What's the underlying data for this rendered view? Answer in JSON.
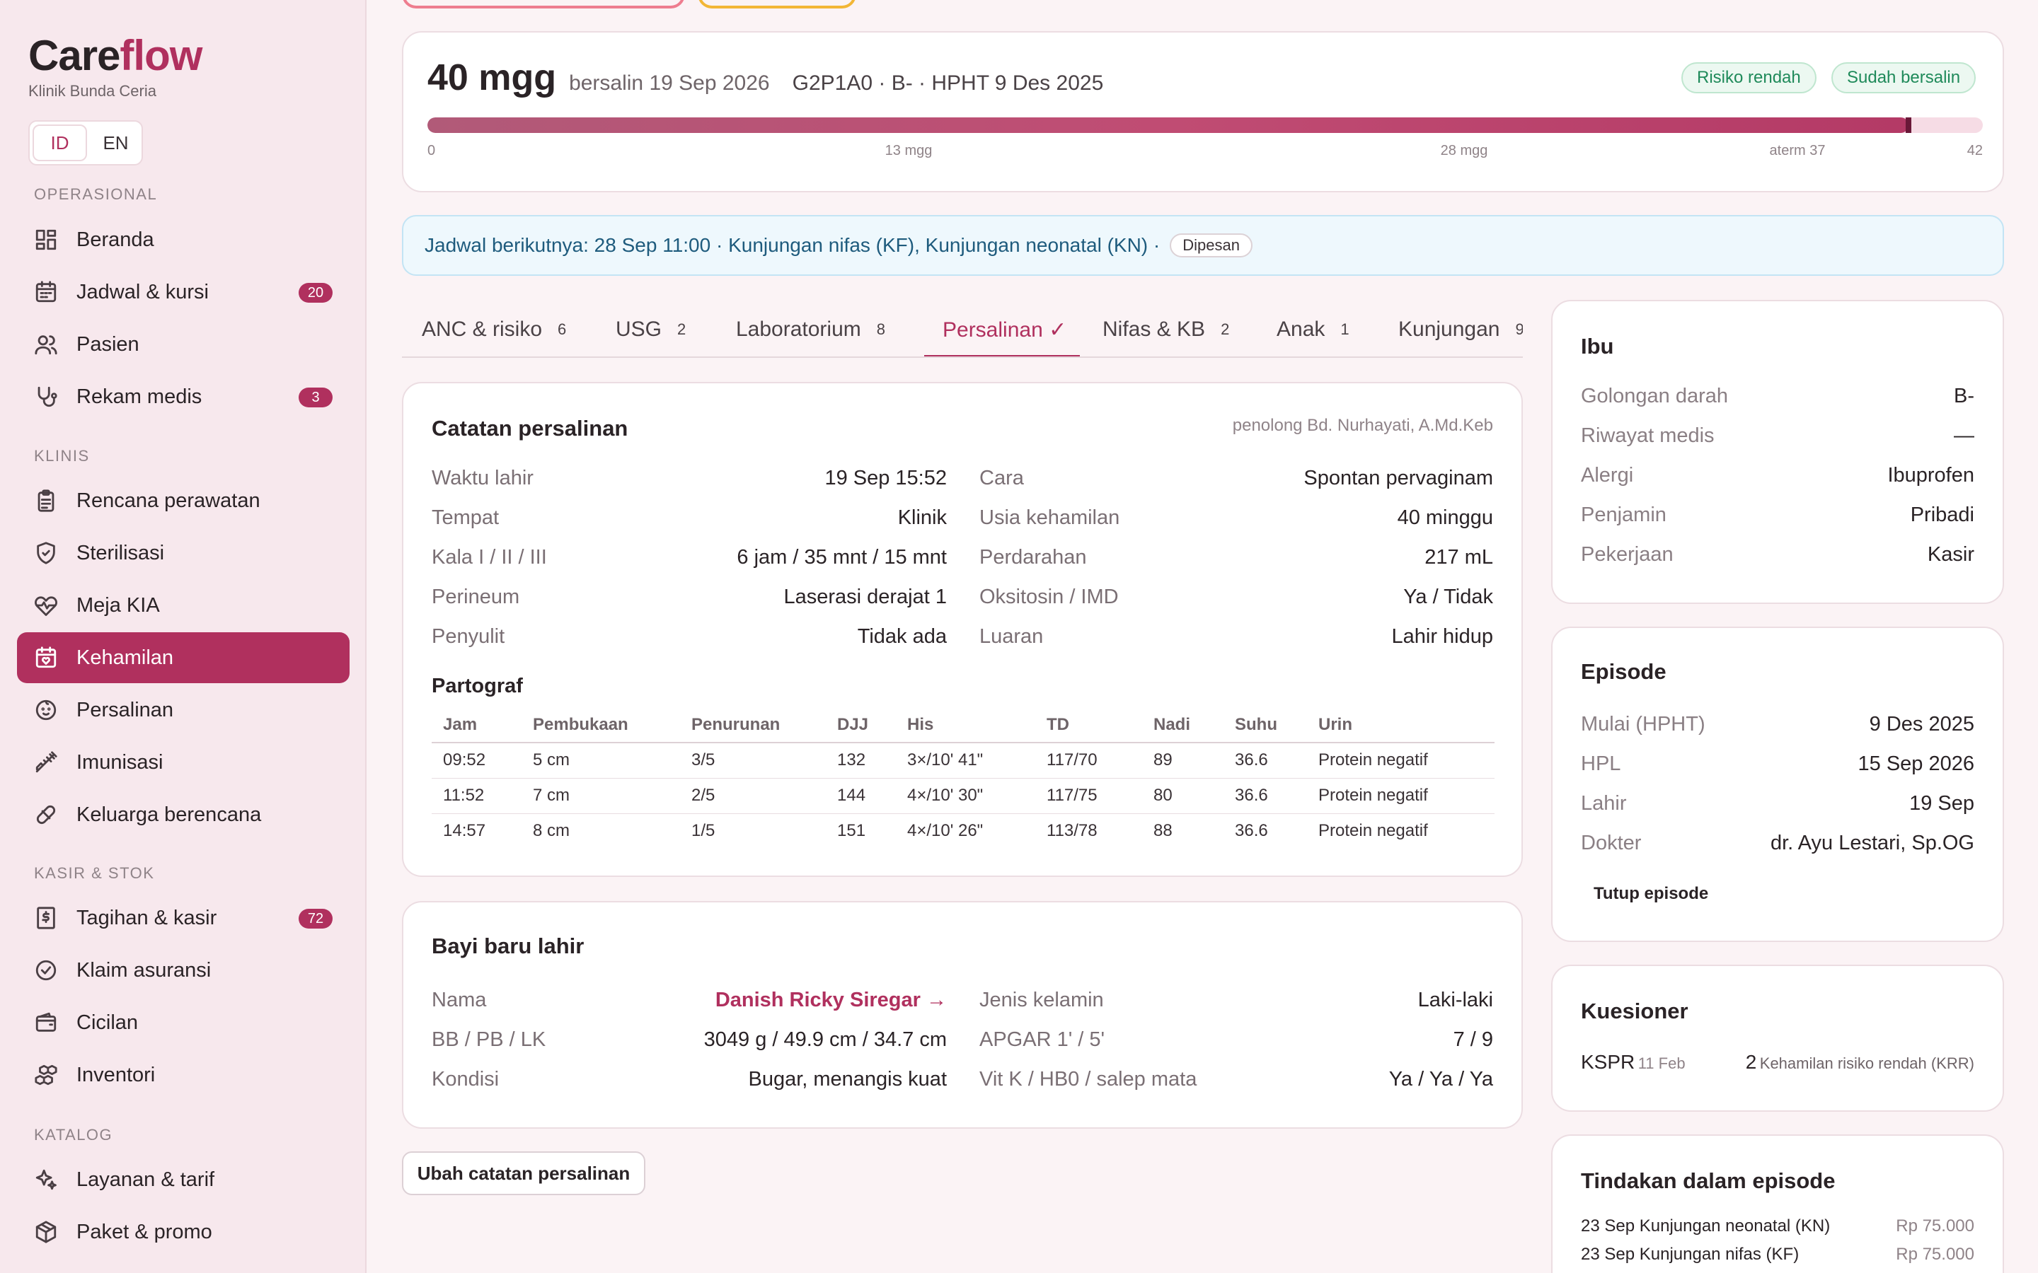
{
  "app": {
    "brand_main": "Care",
    "brand_accent": "flow",
    "clinic": "Klinik Bunda Ceria"
  },
  "lang": {
    "id": "ID",
    "en": "EN",
    "active": "ID"
  },
  "sidebar": {
    "sections": [
      {
        "label": "OPERASIONAL"
      },
      {
        "label": "KLINIS"
      },
      {
        "label": "KASIR & STOK"
      },
      {
        "label": "KATALOG"
      }
    ],
    "items": [
      {
        "label": "Beranda",
        "icon": "dashboard-icon"
      },
      {
        "label": "Jadwal & kursi",
        "icon": "calendar-icon",
        "badge": "20"
      },
      {
        "label": "Pasien",
        "icon": "users-icon"
      },
      {
        "label": "Rekam medis",
        "icon": "stethoscope-icon",
        "badge": "3"
      },
      {
        "label": "Rencana perawatan",
        "icon": "clipboard-icon"
      },
      {
        "label": "Sterilisasi",
        "icon": "shield-icon"
      },
      {
        "label": "Meja KIA",
        "icon": "heart-pulse-icon"
      },
      {
        "label": "Kehamilan",
        "icon": "calendar-heart-icon",
        "active": true
      },
      {
        "label": "Persalinan",
        "icon": "baby-icon"
      },
      {
        "label": "Imunisasi",
        "icon": "syringe-icon"
      },
      {
        "label": "Keluarga berencana",
        "icon": "pill-icon"
      },
      {
        "label": "Tagihan & kasir",
        "icon": "receipt-icon",
        "badge": "72"
      },
      {
        "label": "Klaim asuransi",
        "icon": "check-circle-icon"
      },
      {
        "label": "Cicilan",
        "icon": "wallet-icon"
      },
      {
        "label": "Inventori",
        "icon": "boxes-icon"
      },
      {
        "label": "Layanan & tarif",
        "icon": "sparkles-icon"
      },
      {
        "label": "Paket & promo",
        "icon": "package-icon"
      }
    ]
  },
  "pregnancy": {
    "weeks": "40 mgg",
    "delivered": "bersalin 19 Sep 2026",
    "obstetric": "G2P1A0 · B- · HPHT 9 Des 2025",
    "risk_pill": "Risiko rendah",
    "status_pill": "Sudah bersalin",
    "progress_weeks": 40,
    "max_weeks": 42,
    "ticks": [
      "0",
      "13 mgg",
      "28 mgg",
      "aterm 37",
      "42"
    ]
  },
  "schedule": {
    "text": "Jadwal berikutnya: 28 Sep 11:00 · Kunjungan nifas (KF), Kunjungan neonatal (KN) ·",
    "badge": "Dipesan"
  },
  "tabs": [
    {
      "label": "ANC & risiko",
      "count": "6"
    },
    {
      "label": "USG",
      "count": "2"
    },
    {
      "label": "Laboratorium",
      "count": "8"
    },
    {
      "label": "Persalinan ✓",
      "count": "",
      "active": true
    },
    {
      "label": "Nifas & KB",
      "count": "2"
    },
    {
      "label": "Anak",
      "count": "1"
    },
    {
      "label": "Kunjungan",
      "count": "9"
    }
  ],
  "delivery": {
    "title": "Catatan persalinan",
    "note": "penolong Bd. Nurhayati, A.Md.Keb",
    "left": [
      {
        "label": "Waktu lahir",
        "value": "19 Sep 15:52"
      },
      {
        "label": "Tempat",
        "value": "Klinik"
      },
      {
        "label": "Kala I / II / III",
        "value": "6 jam / 35 mnt / 15 mnt"
      },
      {
        "label": "Perineum",
        "value": "Laserasi derajat 1"
      },
      {
        "label": "Penyulit",
        "value": "Tidak ada"
      }
    ],
    "right": [
      {
        "label": "Cara",
        "value": "Spontan pervaginam"
      },
      {
        "label": "Usia kehamilan",
        "value": "40 minggu"
      },
      {
        "label": "Perdarahan",
        "value": "217 mL"
      },
      {
        "label": "Oksitosin / IMD",
        "value": "Ya / Tidak"
      },
      {
        "label": "Luaran",
        "value": "Lahir hidup"
      }
    ],
    "partograf_title": "Partograf",
    "partograf_headers": [
      "Jam",
      "Pembukaan",
      "Penurunan",
      "DJJ",
      "His",
      "TD",
      "Nadi",
      "Suhu",
      "Urin"
    ],
    "partograf_rows": [
      [
        "09:52",
        "5 cm",
        "3/5",
        "132",
        "3×/10' 41\"",
        "117/70",
        "89",
        "36.6",
        "Protein negatif"
      ],
      [
        "11:52",
        "7 cm",
        "2/5",
        "144",
        "4×/10' 30\"",
        "117/75",
        "80",
        "36.6",
        "Protein negatif"
      ],
      [
        "14:57",
        "8 cm",
        "1/5",
        "151",
        "4×/10' 26\"",
        "113/78",
        "88",
        "36.6",
        "Protein negatif"
      ]
    ]
  },
  "baby": {
    "title": "Bayi baru lahir",
    "left": [
      {
        "label": "Nama",
        "value": "Danish Ricky Siregar →"
      },
      {
        "label": "BB / PB / LK",
        "value": "3049 g / 49.9 cm / 34.7 cm"
      },
      {
        "label": "Kondisi",
        "value": "Bugar, menangis kuat"
      }
    ],
    "right": [
      {
        "label": "Jenis kelamin",
        "value": "Laki-laki"
      },
      {
        "label": "APGAR 1' / 5'",
        "value": "7 / 9"
      },
      {
        "label": "Vit K / HB0 / salep mata",
        "value": "Ya / Ya / Ya"
      }
    ]
  },
  "edit_button": "Ubah catatan persalinan",
  "mother": {
    "title": "Ibu",
    "rows": [
      {
        "label": "Golongan darah",
        "value": "B-"
      },
      {
        "label": "Riwayat medis",
        "value": "—"
      },
      {
        "label": "Alergi",
        "value": "Ibuprofen"
      },
      {
        "label": "Penjamin",
        "value": "Pribadi"
      },
      {
        "label": "Pekerjaan",
        "value": "Kasir"
      }
    ]
  },
  "episode": {
    "title": "Episode",
    "rows": [
      {
        "label": "Mulai (HPHT)",
        "value": "9 Des 2025"
      },
      {
        "label": "HPL",
        "value": "15 Sep 2026"
      },
      {
        "label": "Lahir",
        "value": "19 Sep"
      },
      {
        "label": "Dokter",
        "value": "dr. Ayu Lestari, Sp.OG"
      }
    ],
    "close": "Tutup episode"
  },
  "questionnaire": {
    "title": "Kuesioner",
    "name": "KSPR",
    "date": "11 Feb",
    "score": "2",
    "result": "Kehamilan risiko rendah (KRR)"
  },
  "actions": {
    "title": "Tindakan dalam episode",
    "rows": [
      {
        "label": "23 Sep Kunjungan neonatal (KN)",
        "value": "Rp 75.000"
      },
      {
        "label": "23 Sep Kunjungan nifas (KF)",
        "value": "Rp 75.000"
      }
    ]
  }
}
